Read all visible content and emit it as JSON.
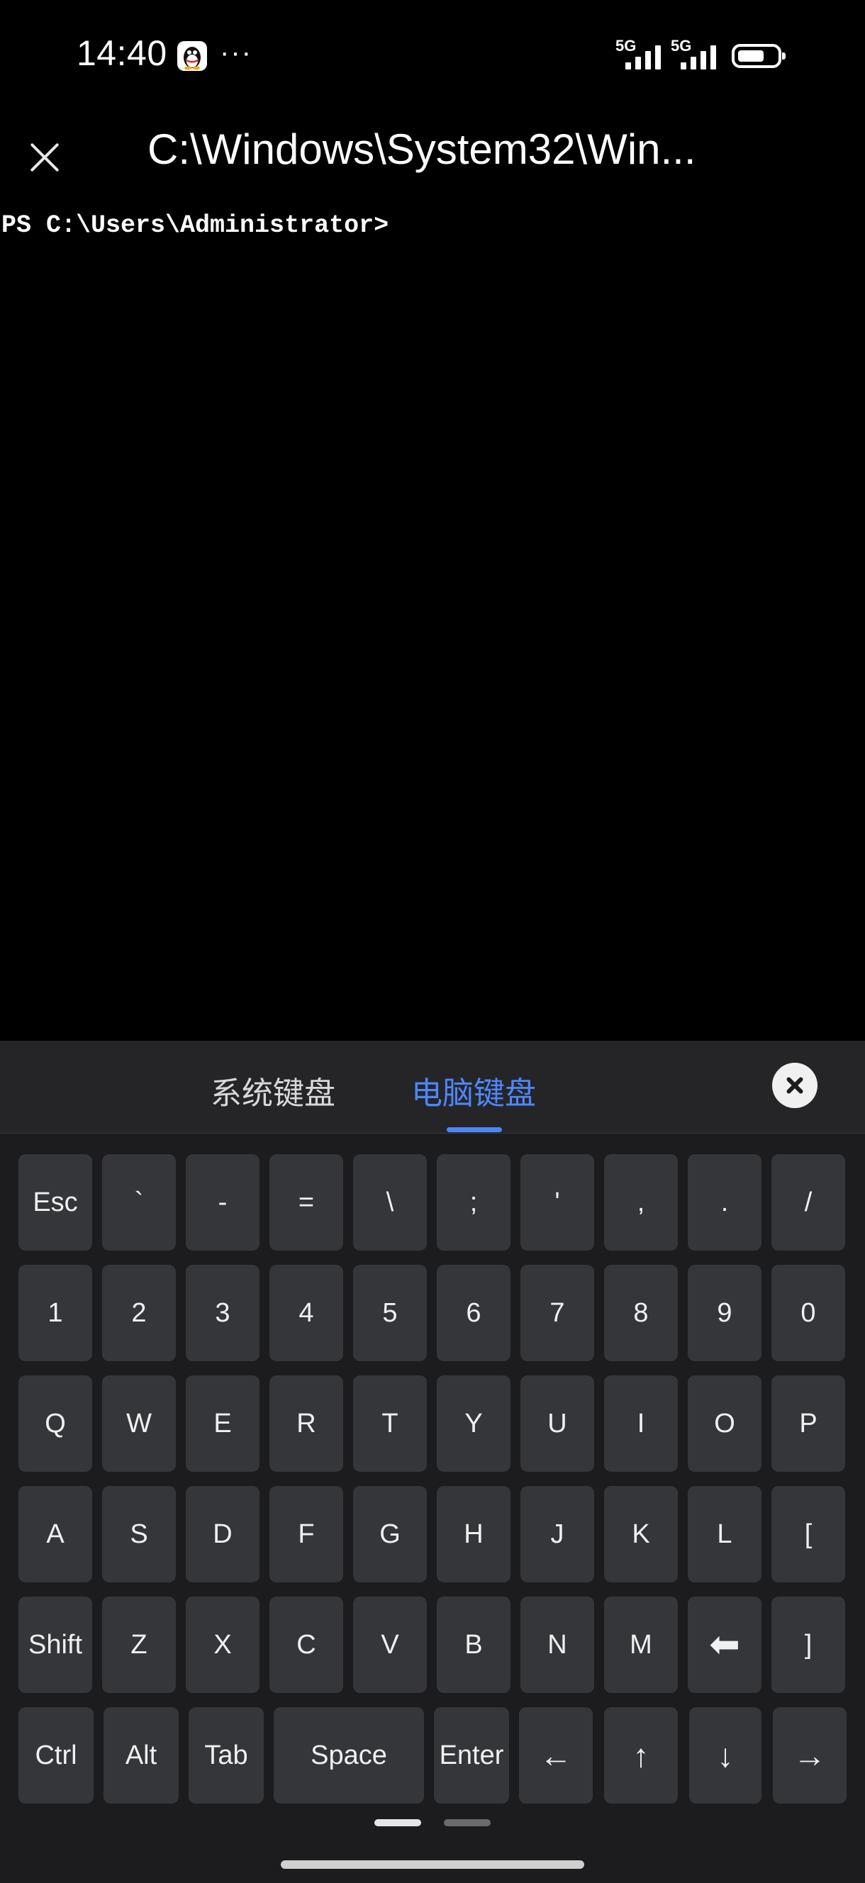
{
  "status_bar": {
    "time": "14:40",
    "more": "···",
    "signal_1_label": "5G",
    "signal_2_label": "5G",
    "icons": [
      "qq-penguin-icon",
      "signal-icon",
      "signal-icon",
      "battery-icon"
    ]
  },
  "titlebar": {
    "title": "C:\\Windows\\System32\\Win...",
    "close_icon": "close-icon"
  },
  "terminal": {
    "prompt": "PS C:\\Users\\Administrator>"
  },
  "keyboard_panel": {
    "tabs": [
      {
        "label": "系统键盘",
        "active": false
      },
      {
        "label": "电脑键盘",
        "active": true
      }
    ],
    "accent_color": "#4f86f7",
    "close_icon": "close-circle-icon",
    "rows": [
      [
        "Esc",
        "`",
        "-",
        "=",
        "\\",
        ";",
        "'",
        ",",
        ".",
        "/"
      ],
      [
        "1",
        "2",
        "3",
        "4",
        "5",
        "6",
        "7",
        "8",
        "9",
        "0"
      ],
      [
        "Q",
        "W",
        "E",
        "R",
        "T",
        "Y",
        "U",
        "I",
        "O",
        "P"
      ],
      [
        "A",
        "S",
        "D",
        "F",
        "G",
        "H",
        "J",
        "K",
        "L",
        "["
      ],
      [
        "Shift",
        "Z",
        "X",
        "C",
        "V",
        "B",
        "N",
        "M",
        "⬅",
        "]"
      ],
      [
        "Ctrl",
        "Alt",
        "Tab",
        "Space",
        "Enter",
        "←",
        "↑",
        "↓",
        "→"
      ]
    ],
    "page_count": 2,
    "active_page": 1
  }
}
